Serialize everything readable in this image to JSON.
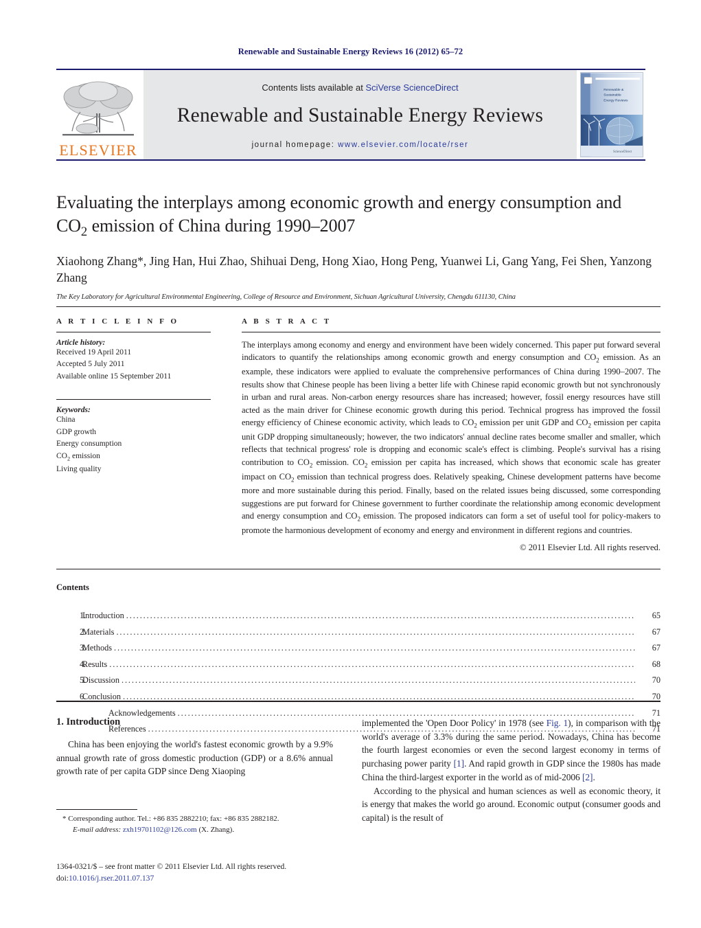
{
  "running_head": "Renewable and Sustainable Energy Reviews 16 (2012) 65–72",
  "masthead": {
    "publisher_name": "ELSEVIER",
    "contents_prefix": "Contents lists available at ",
    "contents_link": "SciVerse ScienceDirect",
    "journal_title": "Renewable and Sustainable Energy Reviews",
    "homepage_prefix": "journal homepage:",
    "homepage_url": "www.elsevier.com/locate/rser",
    "cover_title_line1": "Renewable & ",
    "cover_title_line2": "Sustainable",
    "cover_title_line3": "Energy Reviews",
    "cover_footer": "ScienceDirect"
  },
  "article": {
    "title_line1": "Evaluating the interplays among economic growth and energy consumption and",
    "title_line2_pre": "CO",
    "title_line2_sub": "2",
    "title_line2_post": " emission of China during 1990–2007",
    "authors": "Xiaohong Zhang*, Jing Han, Hui Zhao, Shihuai Deng, Hong Xiao, Hong Peng, Yuanwei Li, Gang Yang, Fei Shen, Yanzong Zhang",
    "affiliation": "The Key Laboratory for Agricultural Environmental Engineering, College of Resource and Environment, Sichuan Agricultural University, Chengdu 611130, China"
  },
  "article_info": {
    "heading": "A R T I C L E   I N F O",
    "history_label": "Article history:",
    "history": [
      "Received 19 April 2011",
      "Accepted 5 July 2011",
      "Available online 15 September 2011"
    ],
    "keywords_label": "Keywords:",
    "keywords": [
      "China",
      "GDP growth",
      "Energy consumption",
      "CO2 emission",
      "Living quality"
    ]
  },
  "abstract": {
    "heading": "A B S T R A C T",
    "text": "The interplays among economy and energy and environment have been widely concerned. This paper put forward several indicators to quantify the relationships among economic growth and energy consumption and CO2 emission. As an example, these indicators were applied to evaluate the comprehensive performances of China during 1990–2007. The results show that Chinese people has been living a better life with Chinese rapid economic growth but not synchronously in urban and rural areas. Non-carbon energy resources share has increased; however, fossil energy resources have still acted as the main driver for Chinese economic growth during this period. Technical progress has improved the fossil energy efficiency of Chinese economic activity, which leads to CO2 emission per unit GDP and CO2 emission per capita unit GDP dropping simultaneously; however, the two indicators' annual decline rates become smaller and smaller, which reflects that technical progress' role is dropping and economic scale's effect is climbing. People's survival has a rising contribution to CO2 emission. CO2 emission per capita has increased, which shows that economic scale has greater impact on CO2 emission than technical progress does. Relatively speaking, Chinese development patterns have become more and more sustainable during this period. Finally, based on the related issues being discussed, some corresponding suggestions are put forward for Chinese government to further coordinate the relationship among economic development and energy consumption and CO2 emission. The proposed indicators can form a set of useful tool for policy-makers to promote the harmonious development of economy and energy and environment in different regions and countries.",
    "copyright": "© 2011 Elsevier Ltd. All rights reserved."
  },
  "contents": {
    "title": "Contents",
    "items": [
      {
        "num": "1.",
        "label": "Introduction",
        "page": "65",
        "sub": false
      },
      {
        "num": "2.",
        "label": "Materials",
        "page": "67",
        "sub": false
      },
      {
        "num": "3.",
        "label": "Methods",
        "page": "67",
        "sub": false
      },
      {
        "num": "4.",
        "label": "Results",
        "page": "68",
        "sub": false
      },
      {
        "num": "5.",
        "label": "Discussion",
        "page": "70",
        "sub": false
      },
      {
        "num": "6.",
        "label": "Conclusion",
        "page": "70",
        "sub": false
      },
      {
        "num": "",
        "label": "Acknowledgements",
        "page": "71",
        "sub": true
      },
      {
        "num": "",
        "label": "References",
        "page": "71",
        "sub": true
      }
    ],
    "dot_leader": "................................................................................................................................................................."
  },
  "body": {
    "section_heading": "1.  Introduction",
    "left_paragraph": "China has been enjoying the world's fastest economic growth by a 9.9% annual growth rate of gross domestic production (GDP) or a 8.6% annual growth rate of per capita GDP since Deng Xiaoping",
    "right_paragraph_1_a": "implemented the 'Open Door Policy' in 1978 (see ",
    "right_paragraph_1_link": "Fig. 1",
    "right_paragraph_1_b": "), in comparison with the world's average of 3.3% during the same period. Nowadays, China has become the fourth largest economies or even the second largest economy in terms of purchasing power parity ",
    "right_paragraph_1_ref1": "[1]",
    "right_paragraph_1_c": ". And rapid growth in GDP since the 1980s has made China the third-largest exporter in the world as of mid-2006 ",
    "right_paragraph_1_ref2": "[2]",
    "right_paragraph_1_d": ".",
    "right_paragraph_2": "According to the physical and human sciences as well as economic theory, it is energy that makes the world go around. Economic output (consumer goods and capital) is the result of"
  },
  "footnote": {
    "corresponding": "* Corresponding author. Tel.: +86 835 2882210; fax: +86 835 2882182.",
    "email_label": "E-mail address:",
    "email": "zxh19701102@126.com",
    "email_suffix": "(X. Zhang).",
    "front_matter": "1364-0321/$ – see front matter © 2011 Elsevier Ltd. All rights reserved.",
    "doi_label": "doi:",
    "doi_value": "10.1016/j.rser.2011.07.137"
  },
  "colors": {
    "link": "#2b3b9e",
    "running_head": "#1a1a6e",
    "elsevier_orange": "#E87722",
    "band_gray": "#e6e7e8"
  }
}
